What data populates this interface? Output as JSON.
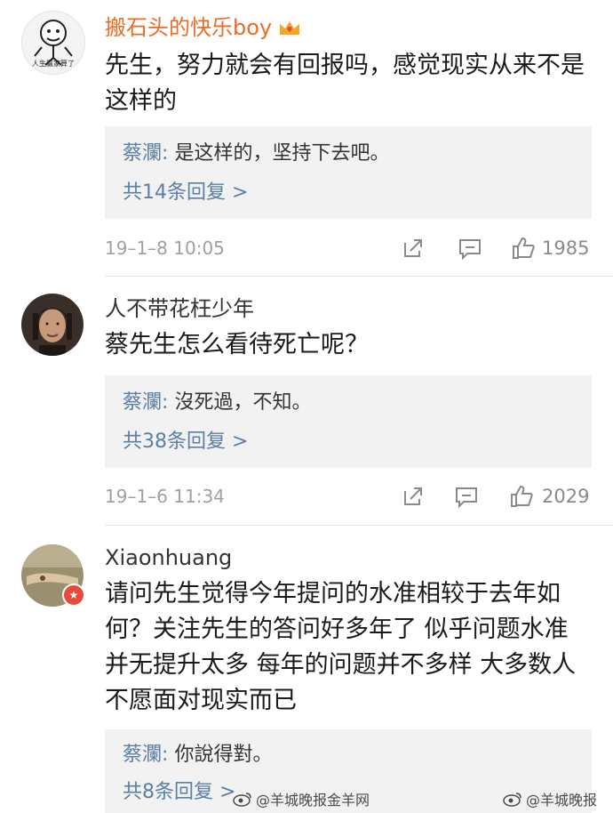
{
  "comments": [
    {
      "username": "搬石头的快乐boy",
      "avatar_caption": "人生赢家算了",
      "text": "先生，努力就会有回报吗，感觉现实从来不是这样的",
      "reply": {
        "author": "蔡瀾",
        "separator": ":",
        "text": "是这样的，坚持下去吧。"
      },
      "reply_count": "共14条回复 >",
      "timestamp": "19–1–8 10:05",
      "likes": "1985"
    },
    {
      "username": "人不带花枉少年",
      "text": "蔡先生怎么看待死亡呢？",
      "reply": {
        "author": "蔡瀾",
        "separator": ":",
        "text": "沒死過，不知。"
      },
      "reply_count": "共38条回复 >",
      "timestamp": "19–1–6 11:34",
      "likes": "2029"
    },
    {
      "username": "Xiaonhuang",
      "text": "请问先生觉得今年提问的水准相较于去年如何？关注先生的答问好多年了 似乎问题水准并无提升太多 每年的问题并不多样 大多数人不愿面对现实而已",
      "reply": {
        "author": "蔡瀾",
        "separator": ":",
        "text": "你說得對。"
      },
      "reply_count": "共8条回复 >"
    }
  ],
  "watermarks": [
    "@羊城晚报金羊网",
    "@羊城晚报"
  ],
  "colors": {
    "vip_username": "#e96d25",
    "link_blue": "#5b7fa5",
    "meta_gray": "#a0a0a0",
    "reply_bg": "#f2f2f2"
  },
  "icons": {
    "share": "share-icon",
    "comment": "comment-icon",
    "like": "thumbs-up-icon"
  }
}
